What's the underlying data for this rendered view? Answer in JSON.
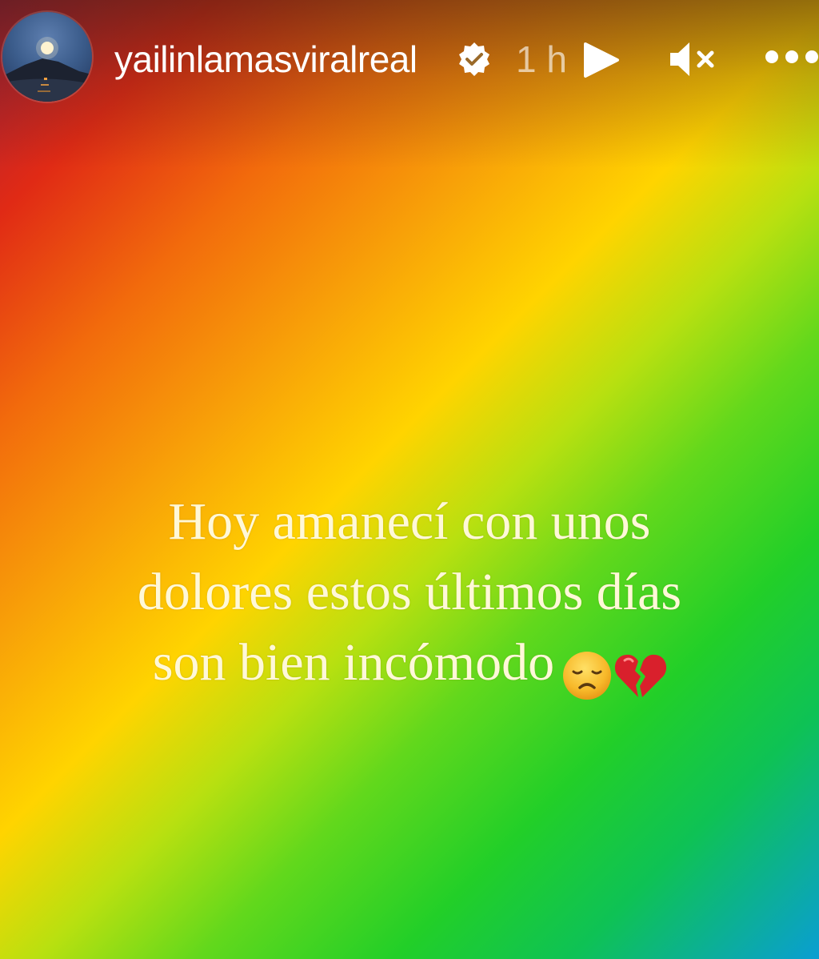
{
  "story": {
    "username": "yailinlamasviralreal",
    "time_ago": "1 h",
    "caption_lines": [
      "Hoy amanecí con unos",
      "dolores estos últimos días",
      "son bien incómodo"
    ],
    "caption_emojis": [
      "disappointed-face-emoji",
      "broken-heart-emoji"
    ]
  },
  "icons": {
    "verified": "verified-badge-icon",
    "play": "play-icon",
    "mute": "muted-speaker-icon",
    "more": "more-options-icon"
  },
  "colors": {
    "gradient_start": "#a81f3a",
    "gradient_middle": "#ffd400",
    "gradient_end": "#0a9ed2",
    "caption_text": "#fff8d8",
    "header_text": "#ffffff"
  }
}
